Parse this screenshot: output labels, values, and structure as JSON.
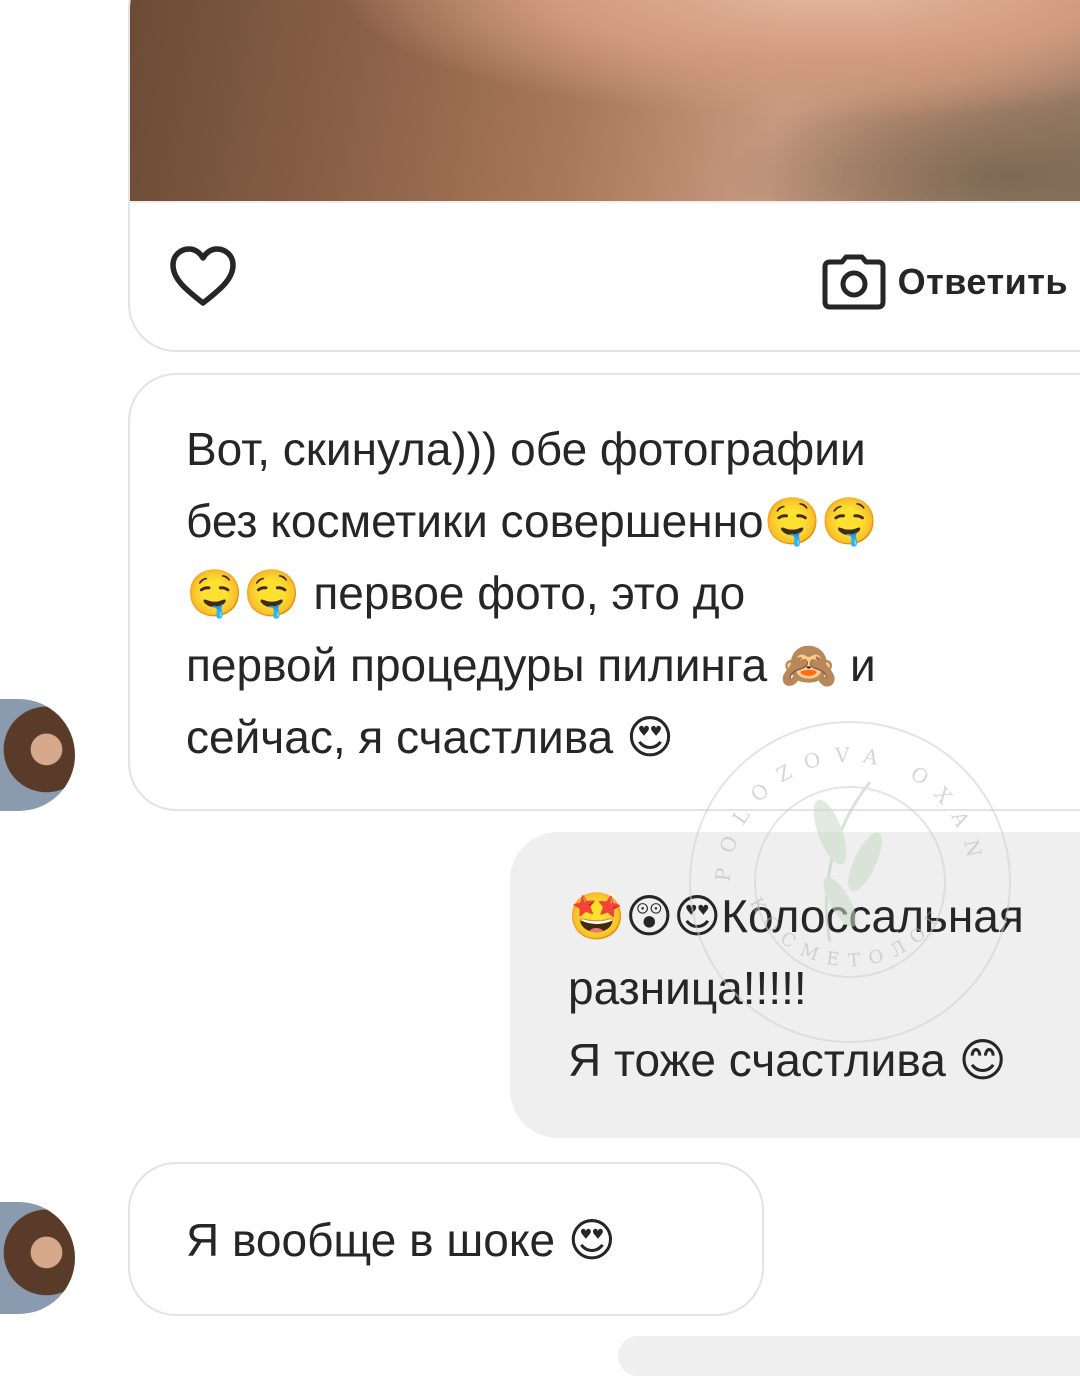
{
  "photo_message": {
    "like_icon": "heart-outline-icon",
    "reply_icon": "camera-icon",
    "reply_label": "Ответить"
  },
  "messages": [
    {
      "direction": "incoming",
      "text": "Вот, скинула))) обе фотографии\nбез косметики совершенно🤤🤤\n🤤🤤 первое фото, это до\nпервой процедуры пилинга 🙈 и\nсейчас, я счастлива 😍"
    },
    {
      "direction": "outgoing",
      "text": "🤩😲😍Колоссальная\nразница!!!!!\nЯ тоже счастлива 😊"
    },
    {
      "direction": "incoming",
      "text": "Я вообще в шоке 😍"
    }
  ],
  "watermark": {
    "top_text": "POLOZOVA OXANA",
    "bottom_text": "КОСМЕТОЛОГ"
  },
  "colors": {
    "incoming_border": "#e3e3e3",
    "outgoing_bg": "#efefef",
    "text": "#262626"
  }
}
